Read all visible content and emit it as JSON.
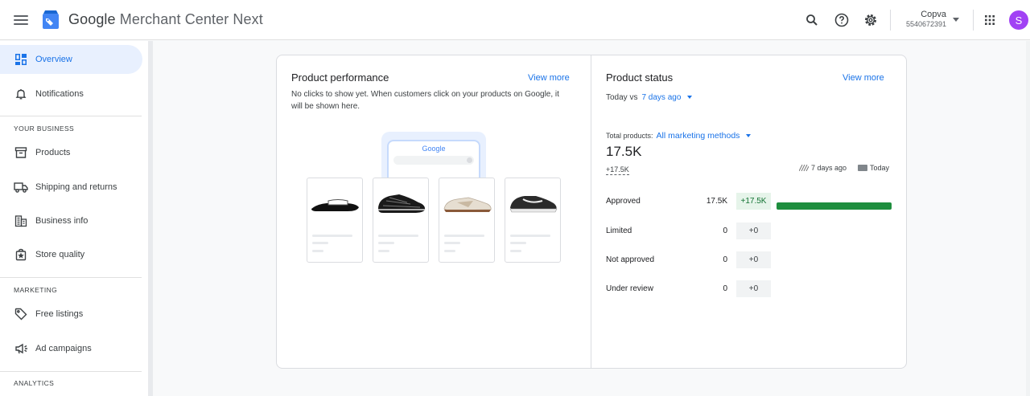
{
  "header": {
    "title_brand": "Google",
    "title_product": "Merchant Center Next",
    "account_name": "Copva",
    "account_id": "5540672391",
    "avatar_initial": "S"
  },
  "sidebar": {
    "items": [
      {
        "label": "Overview",
        "icon": "overview-icon",
        "active": true
      },
      {
        "label": "Notifications",
        "icon": "bell-icon"
      },
      {
        "label": "Products",
        "icon": "products-icon"
      },
      {
        "label": "Shipping and returns",
        "icon": "truck-icon"
      },
      {
        "label": "Business info",
        "icon": "business-icon"
      },
      {
        "label": "Store quality",
        "icon": "store-quality-icon"
      },
      {
        "label": "Free listings",
        "icon": "tag-icon"
      },
      {
        "label": "Ad campaigns",
        "icon": "megaphone-icon"
      }
    ],
    "sections": {
      "your_business": "YOUR BUSINESS",
      "marketing": "MARKETING",
      "analytics": "ANALYTICS"
    }
  },
  "performance": {
    "title": "Product performance",
    "view_more": "View more",
    "description": "No clicks to show yet. When customers click on your products on Google, it will be shown here.",
    "search_logo": "Google"
  },
  "status": {
    "title": "Product status",
    "view_more": "View more",
    "compare_prefix": "Today vs",
    "compare_value": "7 days ago",
    "total_label": "Total products:",
    "total_filter": "All marketing methods",
    "total_value": "17.5K",
    "total_delta": "+17.5K",
    "legend_past": "7 days ago",
    "legend_today": "Today",
    "rows": [
      {
        "label": "Approved",
        "value": "17.5K",
        "delta": "+17.5K"
      },
      {
        "label": "Limited",
        "value": "0",
        "delta": "+0"
      },
      {
        "label": "Not approved",
        "value": "0",
        "delta": "+0"
      },
      {
        "label": "Under review",
        "value": "0",
        "delta": "+0"
      }
    ],
    "approved_fraction": 1.0
  },
  "colors": {
    "accent": "#1a73e8",
    "approved_bar": "#1e8e3e",
    "avatar": "#a142f4"
  }
}
